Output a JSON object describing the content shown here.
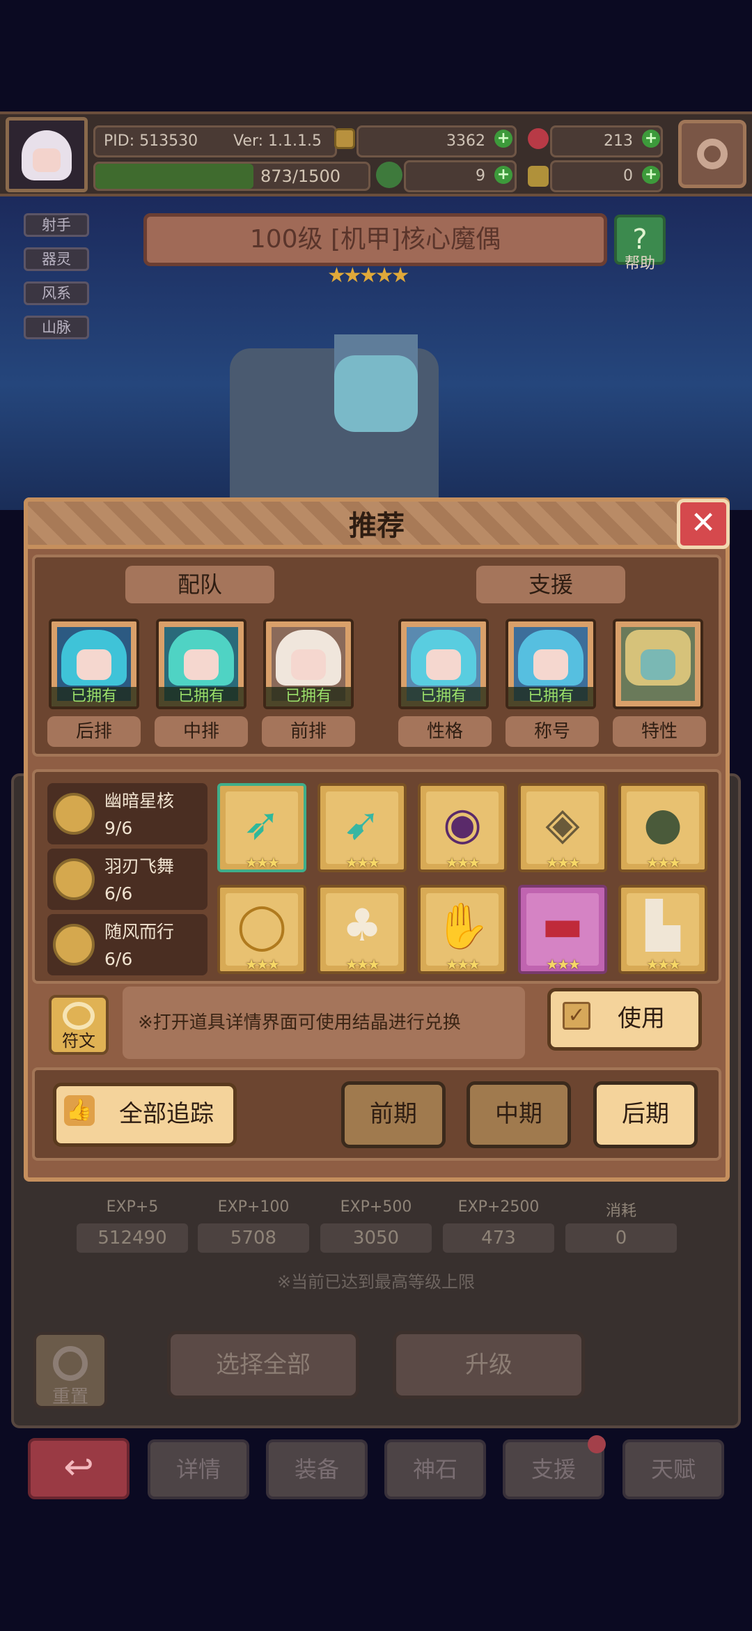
{
  "header": {
    "pid": "PID: 513530",
    "version": "Ver: 1.1.1.5",
    "gold": "3362",
    "gems": "213",
    "exp_bar": "873/1500",
    "clover": "9",
    "keys": "0"
  },
  "hero": {
    "tags": [
      "射手",
      "器灵",
      "风系",
      "山脉"
    ],
    "title": "100级 [机甲]核心魔偶",
    "help_label": "帮助",
    "stars": "★★★★★"
  },
  "dialog": {
    "title": "推荐",
    "close": "✕",
    "team_header": "配队",
    "support_header": "支援",
    "owned_label": "已拥有",
    "team_positions": [
      "后排",
      "中排",
      "前排"
    ],
    "support_positions": [
      "性格",
      "称号",
      "特性"
    ],
    "sets": [
      {
        "name": "幽暗星核",
        "count": "9/6"
      },
      {
        "name": "羽刃飞舞",
        "count": "6/6"
      },
      {
        "name": "随风而行",
        "count": "6/6"
      }
    ],
    "item_stars": "★★★",
    "rune_label": "符文",
    "note": "※打开道具详情界面可使用结晶进行兑换",
    "use_button": "使用",
    "track_all": "全部追踪",
    "stages": [
      "前期",
      "中期",
      "后期"
    ]
  },
  "underlay": {
    "exp_labels": [
      "EXP+5",
      "EXP+100",
      "EXP+500",
      "EXP+2500",
      "消耗"
    ],
    "exp_values": [
      "512490",
      "5708",
      "3050",
      "473",
      "0"
    ],
    "max_note": "※当前已达到最高等级上限",
    "reset_label": "重置",
    "select_all": "选择全部",
    "upgrade": "升级"
  },
  "nav": [
    "详情",
    "装备",
    "神石",
    "支援",
    "天赋"
  ],
  "colors": {
    "accent": "#c58f5d",
    "owned": "#9be06a",
    "close": "#d5494d"
  }
}
